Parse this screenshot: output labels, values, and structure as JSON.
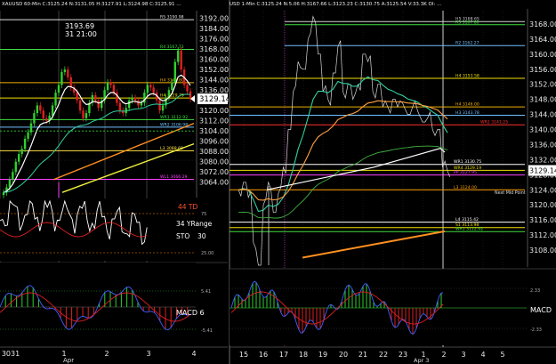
{
  "chart_data": [
    {
      "id": "left",
      "type": "line",
      "title": "XAUUSD 60-Min C:3125.24 N:3131.05 H:3127.91 L:3124.98 C:3125.91 ...",
      "cursor_price": "3193.69",
      "cursor_time": "31 21:00",
      "price_ylim": [
        3052,
        3198
      ],
      "series": [
        {
          "name": "close",
          "values": [
            3056,
            3060,
            3066,
            3072,
            3080,
            3086,
            3090,
            3098,
            3103,
            3110,
            3118,
            3124,
            3120,
            3114,
            3112,
            3116,
            3124,
            3134,
            3140,
            3150,
            3152,
            3146,
            3138,
            3134,
            3128,
            3120,
            3114,
            3118,
            3126,
            3132,
            3128,
            3122,
            3128,
            3136,
            3142,
            3140,
            3134,
            3126,
            3120,
            3118,
            3122,
            3128,
            3130,
            3128,
            3124,
            3126,
            3134,
            3140,
            3138,
            3134,
            3128,
            3120,
            3124,
            3130,
            3136,
            3142,
            3158,
            3167,
            3152,
            3140,
            3135,
            3129
          ]
        }
      ],
      "levels": [
        {
          "label": "R5 3190.98",
          "value": 3190.98,
          "color": "#e0e0e0"
        },
        {
          "label": "R4 3167.73",
          "value": 3167.73,
          "color": "#3fe03f"
        },
        {
          "label": "H4 3141.80",
          "value": 3141.8,
          "color": "#f0b000"
        },
        {
          "label": "H4 3129.79",
          "value": 3129.79,
          "color": "#f0e000"
        },
        {
          "label": "WR1 3112.92",
          "value": 3112.92,
          "color": "#3fe03f"
        },
        {
          "label": "WR2 3106.98",
          "value": 3106.98,
          "color": "#70c0ff"
        },
        {
          "label": "L3 3088.60",
          "value": 3088.6,
          "color": "#ffe040"
        },
        {
          "label": "WL1 3066.29",
          "value": 3066.29,
          "color": "#ff40ff"
        }
      ],
      "price_ticks": [
        "3192.00",
        "3184.00",
        "3176.00",
        "3168.00",
        "3160.00",
        "3152.00",
        "3144.00",
        "3136.00",
        "3128.00",
        "3120.00",
        "3112.00",
        "3104.00",
        "3096.00",
        "3088.00",
        "3080.00",
        "3072.00",
        "3064.00"
      ],
      "last_price": "3129.14",
      "stoch_labels": {
        "top": "44 TD",
        "mid": "34 YRange",
        "stoch": "STO",
        "stoch_val": "30"
      },
      "stoch_ticks": [
        "75",
        "25.00"
      ],
      "macd_label": "MACD 6",
      "macd_ticks": [
        "5.41",
        "-5.41"
      ],
      "x_ticks": [
        "3031",
        "1",
        "2",
        "3",
        "4"
      ],
      "x_sublabel": "Apr"
    },
    {
      "id": "right",
      "type": "line",
      "title": "USD 1-Min C:3125.24 N:5.06 H:3167.66 L:3123.23 C:3130.75 A:3125.54 V:33.3K OI: ...",
      "price_ylim": [
        3104,
        3172
      ],
      "price_ticks": [
        "3168.00",
        "3164.00",
        "3160.00",
        "3156.00",
        "3152.00",
        "3148.00",
        "3144.00",
        "3140.00",
        "3136.00",
        "3132.00",
        "3128.00",
        "3124.00",
        "3120.00",
        "3116.00",
        "3112.00",
        "3108.00"
      ],
      "last_price": "3129.14",
      "series": [
        {
          "name": "price",
          "values": [
            3124,
            3126,
            3122,
            3110,
            3104,
            3120,
            3126,
            3118,
            3123,
            3130,
            3140,
            3150,
            3158,
            3156,
            3164,
            3170,
            3160,
            3150,
            3148,
            3155,
            3162,
            3150,
            3152,
            3148,
            3152,
            3160,
            3158,
            3150,
            3152,
            3146,
            3146,
            3148,
            3146,
            3147,
            3144,
            3146,
            3145,
            3142,
            3143,
            3140,
            3140,
            3130,
            3129
          ]
        }
      ],
      "levels": [
        {
          "label": "H5 3168.65",
          "value": 3168.65,
          "color": "#d0d0d0"
        },
        {
          "label": "R3 3167.80",
          "value": 3167.8,
          "color": "#3fe03f"
        },
        {
          "label": "R2 3162.27",
          "value": 3162.27,
          "color": "#70c0ff"
        },
        {
          "label": "H4 3153.58",
          "value": 3153.58,
          "color": "#f0e000"
        },
        {
          "label": "H4 3146.00",
          "value": 3146.0,
          "color": "#f0b000"
        },
        {
          "label": "H3 3143.78",
          "value": 3143.78,
          "color": "#70c0ff"
        },
        {
          "label": "WR2 3141.25",
          "value": 3141.25,
          "color": "#ff3030"
        },
        {
          "label": "WR1 3130.75",
          "value": 3130.75,
          "color": "#ffffff"
        },
        {
          "label": "WR4 3129.19",
          "value": 3129.19,
          "color": "#f0e000"
        },
        {
          "label": "PP 3127.95",
          "value": 3127.95,
          "color": "#ff40ff"
        },
        {
          "label": "L3 3124.00",
          "value": 3124.0,
          "color": "#ffa000"
        },
        {
          "label": "L4 3115.42",
          "value": 3115.42,
          "color": "#ffffff"
        },
        {
          "label": "S1 3113.98",
          "value": 3113.98,
          "color": "#f0e000"
        },
        {
          "label": "WR1 3112.92",
          "value": 3112.92,
          "color": "#3fe03f"
        }
      ],
      "annotation": "Next Mid Point",
      "macd_label": "MACD",
      "macd_ticks": [
        "2.33",
        "-2.33"
      ],
      "x_ticks": [
        "15",
        "16",
        "17",
        "18",
        "19",
        "20",
        "21",
        "22",
        "23",
        "1",
        "2",
        "3",
        "4",
        "5"
      ],
      "x_sublabel": "Apr 3"
    }
  ]
}
